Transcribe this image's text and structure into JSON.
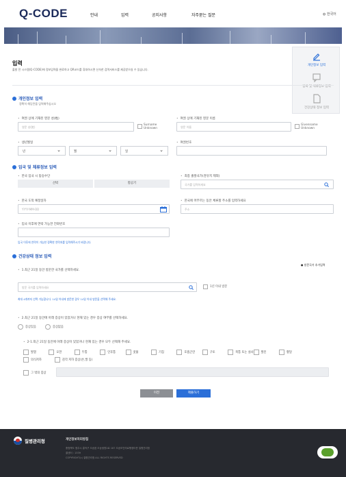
{
  "header": {
    "logo": "Q-CODE",
    "nav": [
      "안내",
      "입력",
      "공지사항",
      "자주묻는 질문"
    ],
    "lang": "한국어"
  },
  "sidebar": {
    "items": [
      {
        "label": "개인정보 입력"
      },
      {
        "label": "입국 및 체류정보 입력"
      },
      {
        "label": "건강상태 정보 입력"
      }
    ]
  },
  "page": {
    "title": "입력",
    "desc": "출발 전 시스템(Q-CODE)에 정보입력을 완료하고 QR코드를 휴대하시면 신속한 검역서비스를 제공받으실 수 있습니다."
  },
  "personal": {
    "title": "개인정보 입력",
    "subtitle": "정확히 해당란을 입력해주십시오",
    "surname_label": "여권 상에 기재된 영문 성(姓)",
    "surname_placeholder": "영문 성(姓)",
    "surname_unknown": "Surname Unknown",
    "given_label": "여권 상에 기재된 영문 이름",
    "given_placeholder": "영문 이름",
    "given_unknown": "Givenname Unknown",
    "birth_label": "생년월일",
    "birth_year": "년",
    "birth_month": "월",
    "birth_day": "일",
    "passport_label": "여권번호"
  },
  "entry": {
    "title": "입국 및 체류정보 입력",
    "transport_label": "한국 입국 시 탑승수단",
    "transport_options": [
      "선박",
      "항공기"
    ],
    "dep_country_label": "최종 출발국가(경유지 제외)",
    "dep_country_placeholder": "국가를 입력하세요",
    "date_label": "한국 도착 예정일자",
    "date_placeholder": "YYYY-MM-DD",
    "address_label": "한국에 머무르는 동안 체류할 주소를 입력하세요",
    "address_placeholder": "주소",
    "contact_label": "입국 이후에 연락 가능한 전화번호",
    "note": "입국 이후에 연락이 가능한 정확한 연락처를 입력해주시기 바랍니다."
  },
  "health": {
    "title": "건강상태 정보 입력",
    "add_link": "방문국가 추가입력",
    "q1": "1.최근 21일 동안 방문한 국가를 선택하세요.",
    "q1_placeholder": "방문 국가를 입력하세요",
    "q1_check": "1년 이내 방문",
    "q1_note": "최대 4개까지 선택 가능합니다. 14일 이내에 방문한 경우 14일 이내 방문을 선택해 주세요.",
    "q2": "2.최근 21일 동안에 아래 증상이 있었거나 현재 있는 경우 증상 여부를 선택하세요.",
    "q2_options": [
      "증상있음",
      "증상없음"
    ],
    "q21": "2-1.최근 21일 동안에 아래 증상이 있었거나 현재 있는 경우 모두 선택해 주세요.",
    "symptoms_row1": [
      "발열",
      "오한",
      "두통",
      "인후통",
      "콧물",
      "기침",
      "호흡곤란",
      "구토",
      "복통 또는 설사",
      "발진",
      "황달"
    ],
    "symptoms_row2": [
      "의식저하",
      "감각 저하 증상(손,발 등)"
    ],
    "other": "그 밖의 증상"
  },
  "actions": {
    "prev": "이전",
    "submit": "제출하기"
  },
  "footer": {
    "org": "질병관리청",
    "title": "개인정보처리방침",
    "addr1": "충청북도 청주시 흥덕구 오송읍 오송생명2로 187 오송보건의료행정타운 질병관리청",
    "addr2": "콜센터 : 1339",
    "copy": "COPYRIGHT(c) 질병관리청 ALL RIGHTS RESERVED"
  },
  "colors": {
    "accent": "#2b6fd8",
    "navy": "#1b2a5a",
    "footer": "#27292f"
  }
}
